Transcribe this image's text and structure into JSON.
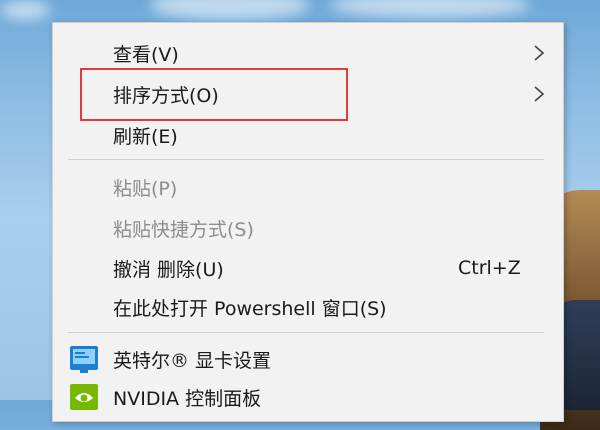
{
  "desktop": {
    "sky_color": "#8cbde4"
  },
  "context_menu": {
    "items": [
      {
        "label": "查看(V)",
        "shortcut": "",
        "has_submenu": true,
        "disabled": false
      },
      {
        "label": "排序方式(O)",
        "shortcut": "",
        "has_submenu": true,
        "disabled": false
      },
      {
        "label": "刷新(E)",
        "shortcut": "",
        "has_submenu": false,
        "disabled": false
      },
      {
        "label": "粘贴(P)",
        "shortcut": "",
        "has_submenu": false,
        "disabled": true
      },
      {
        "label": "粘贴快捷方式(S)",
        "shortcut": "",
        "has_submenu": false,
        "disabled": true
      },
      {
        "label": "撤消 删除(U)",
        "shortcut": "Ctrl+Z",
        "has_submenu": false,
        "disabled": false
      },
      {
        "label": "在此处打开 Powershell 窗口(S)",
        "shortcut": "",
        "has_submenu": false,
        "disabled": false
      },
      {
        "label": "英特尔® 显卡设置",
        "shortcut": "",
        "has_submenu": false,
        "disabled": false,
        "icon": "intel-graphics-icon"
      },
      {
        "label": "NVIDIA 控制面板",
        "shortcut": "",
        "has_submenu": false,
        "disabled": false,
        "icon": "nvidia-icon"
      }
    ],
    "highlight_color": "#e23b3b",
    "disabled_color": "#8d8d8d"
  }
}
